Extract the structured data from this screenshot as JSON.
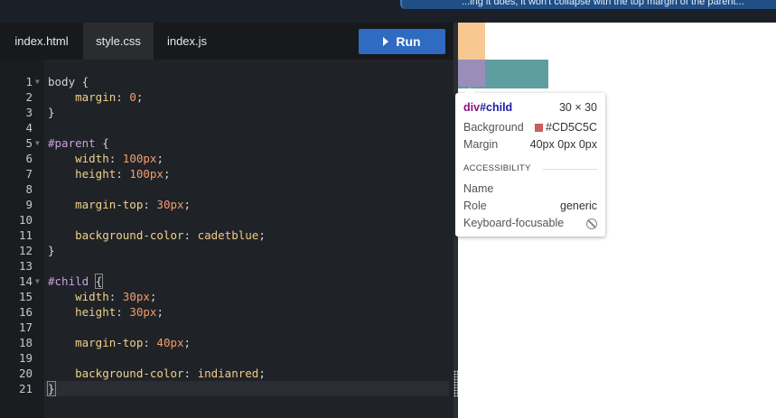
{
  "notice": {
    "text": "...ing it does, it won't collapse with the top margin of the parent..."
  },
  "tabs": [
    {
      "label": "index.html"
    },
    {
      "label": "style.css"
    },
    {
      "label": "index.js"
    }
  ],
  "run_label": "Run",
  "code_lines": [
    {
      "n": "1",
      "fold": true
    },
    {
      "n": "2"
    },
    {
      "n": "3"
    },
    {
      "n": "4"
    },
    {
      "n": "5",
      "fold": true
    },
    {
      "n": "6"
    },
    {
      "n": "7"
    },
    {
      "n": "8"
    },
    {
      "n": "9"
    },
    {
      "n": "10"
    },
    {
      "n": "11"
    },
    {
      "n": "12"
    },
    {
      "n": "13"
    },
    {
      "n": "14",
      "fold": true
    },
    {
      "n": "15"
    },
    {
      "n": "16"
    },
    {
      "n": "17"
    },
    {
      "n": "18"
    },
    {
      "n": "19"
    },
    {
      "n": "20"
    },
    {
      "n": "21"
    }
  ],
  "code": {
    "l1": "body {",
    "l2a": "    margin",
    "l2b": ": ",
    "l2c": "0",
    "l2d": ";",
    "l3": "}",
    "l5a": "#parent",
    "l5b": " {",
    "l6a": "    width",
    "l6b": ": ",
    "l6c": "100",
    "l6d": "px",
    "l6e": ";",
    "l7a": "    height",
    "l7b": ": ",
    "l7c": "100",
    "l7d": "px",
    "l7e": ";",
    "l9a": "    margin-top",
    "l9b": ": ",
    "l9c": "30",
    "l9d": "px",
    "l9e": ";",
    "l11a": "    background-color",
    "l11b": ": ",
    "l11c": "cadetblue",
    "l11d": ";",
    "l12": "}",
    "l14a": "#child",
    "l14b": " ",
    "l14c": "{",
    "l15a": "    width",
    "l15b": ": ",
    "l15c": "30",
    "l15d": "px",
    "l15e": ";",
    "l16a": "    height",
    "l16b": ": ",
    "l16c": "30",
    "l16d": "px",
    "l16e": ";",
    "l18a": "    margin-top",
    "l18b": ": ",
    "l18c": "40",
    "l18d": "px",
    "l18e": ";",
    "l20a": "    background-color",
    "l20b": ": ",
    "l20c": "indianred",
    "l20d": ";",
    "l21": "}"
  },
  "tooltip": {
    "tag": "div",
    "id": "#child",
    "size": "30 × 30",
    "background_label": "Background",
    "background_value": "#CD5C5C",
    "margin_label": "Margin",
    "margin_value": "40px 0px 0px",
    "accessibility_heading": "ACCESSIBILITY",
    "name_label": "Name",
    "role_label": "Role",
    "role_value": "generic",
    "keyboard_label": "Keyboard-focusable"
  },
  "colors": {
    "run_button": "#2f6bc0",
    "parent_box": "#5f9ea0",
    "child_box_overlay": "#9b8db8",
    "margin_overlay": "#f7c892",
    "background_swatch": "#cd5c5c"
  },
  "icons": [
    "fold-arrow-icon",
    "play-icon",
    "no-entry-icon",
    "drag-grip-icon"
  ]
}
